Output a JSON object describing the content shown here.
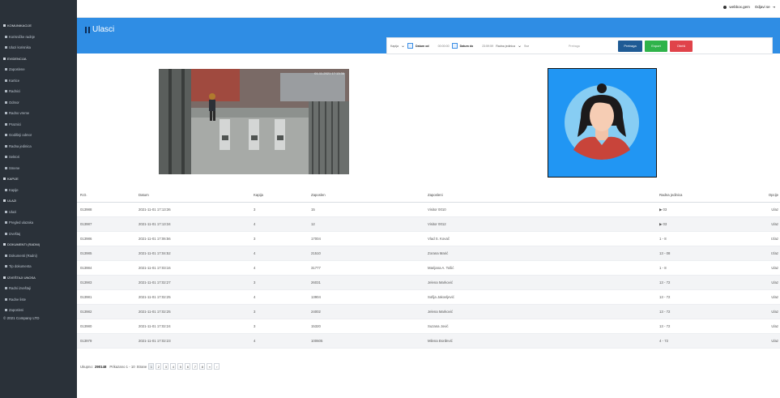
{
  "sidebar": {
    "sections": [
      {
        "title": "KOMUNIKACIJE",
        "items": [
          "Korisničke radnje",
          "Ulazi korisnika"
        ]
      },
      {
        "title": "EVIDENCIJA",
        "items": [
          "Zaposlene",
          "Kartice",
          "Radnici",
          "Odmor",
          "Radno vreme",
          "Praznici",
          "Godišnji odmor",
          "Radna jedinica",
          "Sektori",
          "Smene"
        ]
      },
      {
        "title": "KAPIJE",
        "items": [
          "Kapije"
        ]
      },
      {
        "title": "ULAZI",
        "items": [
          "Ulazi",
          "Pregled ulazaka",
          "Izveštaj"
        ]
      },
      {
        "title": "DOKUMENTI (RADNI)",
        "items": [
          "Dokumenti (Radni)",
          "Tip dokumenta"
        ]
      },
      {
        "title": "IZVEŠTAJI UNOSA",
        "items": [
          "Radni izveštaji",
          "Radne liste",
          "Zaposleni"
        ]
      }
    ],
    "copyright": "© 2021   Company LTD"
  },
  "topbar": {
    "user": "webbox.gem",
    "logout": "Odjavi se"
  },
  "page": {
    "title": "Ulasci"
  },
  "filter": {
    "kapija_label": "Kapija",
    "datum_od_label": "Datum od",
    "datum_od_time": "00:00:00",
    "datum_do_label": "Datum do",
    "datum_do_time": "23:59:59",
    "radna_jedinica_label": "Radna jedinica",
    "radna_jedinica_value": "Sve",
    "search_placeholder": "Pretraga",
    "search_button": "Pretraga",
    "export_button": "Export",
    "reset_button": "Obriši"
  },
  "camera": {
    "timestamp": "01-11-2021 17:13:36"
  },
  "table": {
    "headers": [
      "R.D.",
      "Datum",
      "Kapija",
      "Zaposlen",
      "Zaposleni",
      "Radna jedinica",
      "Opcije"
    ],
    "rows": [
      {
        "rd": "013988",
        "datum": "2021-11-01 17:13:36",
        "kapija": "3",
        "zaposlen": "15",
        "ime": "Visitor 0010",
        "jedinica": "▶ 03",
        "opcija": "Ulaz"
      },
      {
        "rd": "013987",
        "datum": "2021-11-01 17:13:34",
        "kapija": "4",
        "zaposlen": "12",
        "ime": "Visitor 0012",
        "jedinica": "▶ 03",
        "opcija": "Ulaz"
      },
      {
        "rd": "013986",
        "datum": "2021-11-01 17:06:56",
        "kapija": "3",
        "zaposlen": "17004",
        "ime": "Vlad S. Kovač",
        "jedinica": "1 - 8",
        "opcija": "Izlaz"
      },
      {
        "rd": "013985",
        "datum": "2021-11-01 17:04:52",
        "kapija": "4",
        "zaposlen": "21510",
        "ime": "Zorana Marić",
        "jedinica": "13 - 08",
        "opcija": "Izlaz"
      },
      {
        "rd": "013984",
        "datum": "2021-11-01 17:03:16",
        "kapija": "4",
        "zaposlen": "31777",
        "ime": "Marijana A. Tošić",
        "jedinica": "1 - 8",
        "opcija": "Ulaz"
      },
      {
        "rd": "013983",
        "datum": "2021-11-01 17:02:27",
        "kapija": "3",
        "zaposlen": "26031",
        "ime": "Jelena Marković",
        "jedinica": "13 - 72",
        "opcija": "Ulaz"
      },
      {
        "rd": "013981",
        "datum": "2021-11-01 17:02:25",
        "kapija": "4",
        "zaposlen": "13904",
        "ime": "Sofija Jakovljević",
        "jedinica": "13 - 72",
        "opcija": "Ulaz"
      },
      {
        "rd": "013982",
        "datum": "2021-11-01 17:02:25",
        "kapija": "3",
        "zaposlen": "24002",
        "ime": "Jelena Marković",
        "jedinica": "13 - 72",
        "opcija": "Ulaz"
      },
      {
        "rd": "013980",
        "datum": "2021-11-01 17:02:24",
        "kapija": "3",
        "zaposlen": "15320",
        "ime": "Suzana Jović",
        "jedinica": "13 - 72",
        "opcija": "Ulaz"
      },
      {
        "rd": "013979",
        "datum": "2021-11-01 17:02:23",
        "kapija": "4",
        "zaposlen": "100605",
        "ime": "Milena Đorđević",
        "jedinica": "4 - 72",
        "opcija": "Ulaz"
      }
    ]
  },
  "pager": {
    "total_label": "Ukupno:",
    "total_value": "290148",
    "range_label": "Prikazano 1 - 10",
    "pages_label": "Strane",
    "pages": [
      "1",
      "2",
      "3",
      "4",
      "5",
      "6",
      "7",
      "8",
      "»",
      "›"
    ]
  },
  "colors": {
    "band": "#2f8de4",
    "sidebar": "#2a3139",
    "avatar_bg": "#2196f3",
    "btn_search": "#1f5b95",
    "btn_export": "#2fb34a",
    "btn_reset": "#e0434a"
  }
}
